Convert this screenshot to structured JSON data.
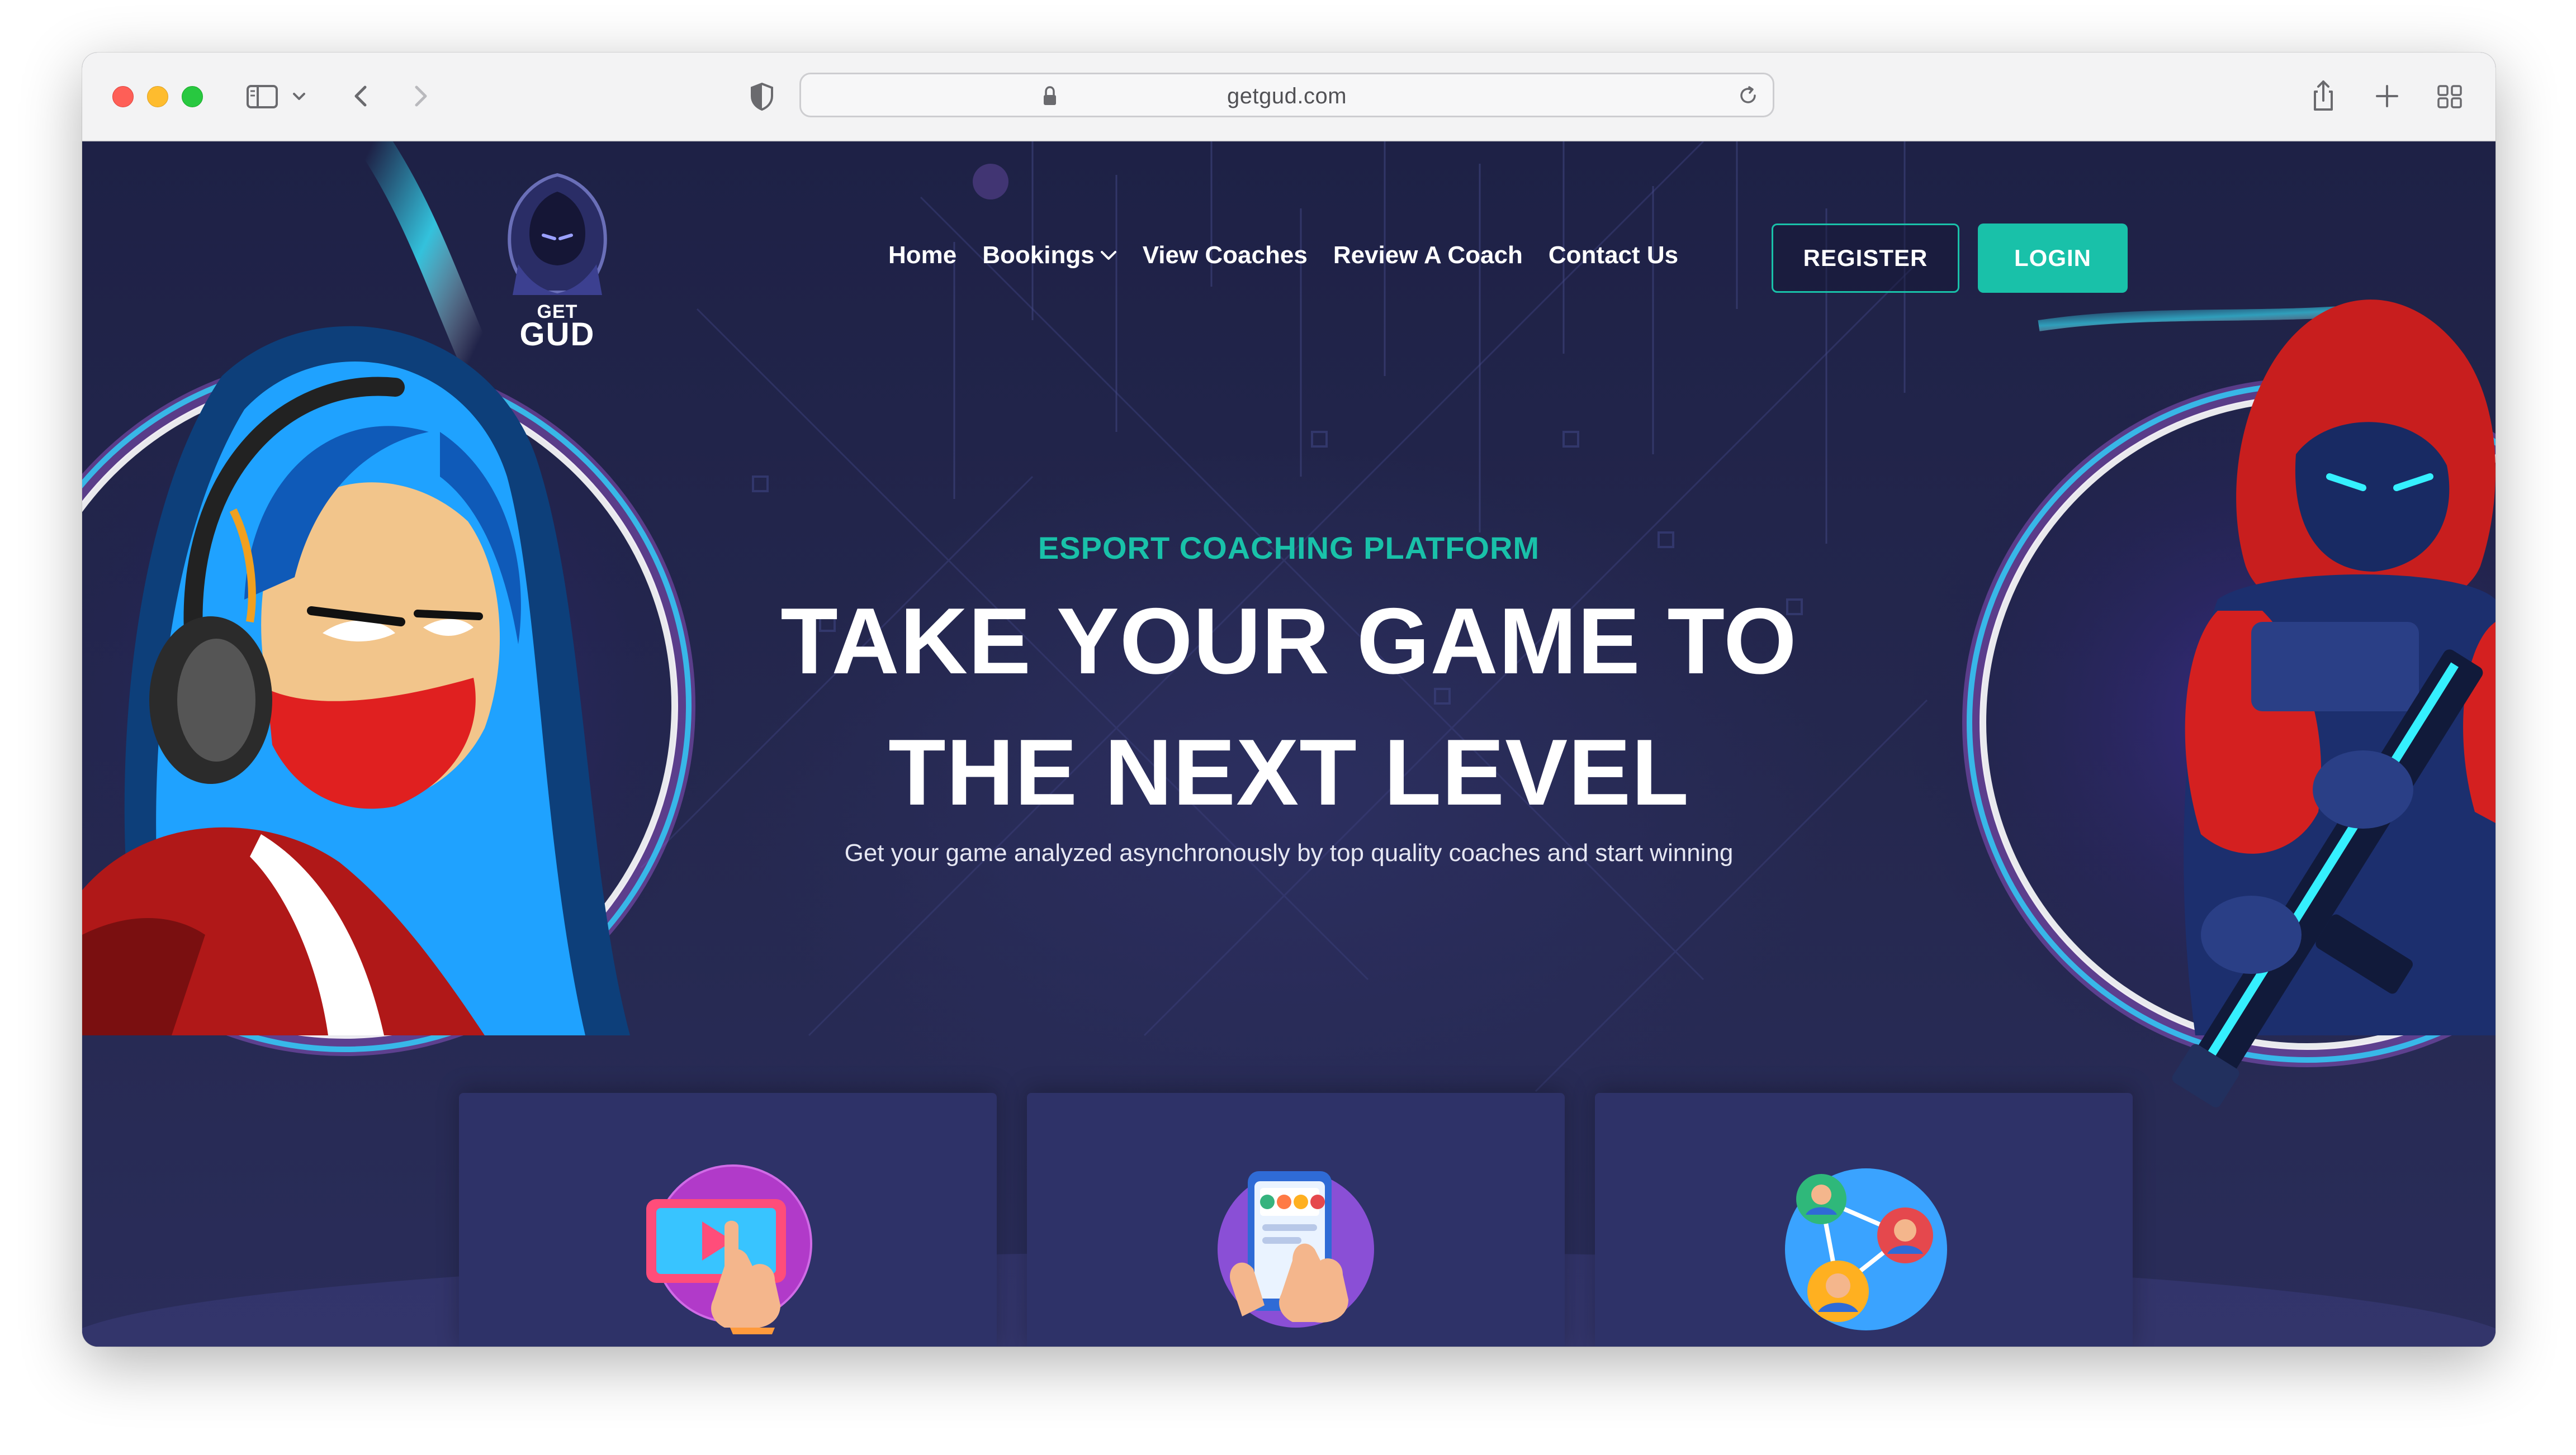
{
  "browser": {
    "url": "getgud.com"
  },
  "logo": {
    "line1": "GET",
    "line2": "GUD"
  },
  "nav": {
    "items": [
      "Home",
      "Bookings",
      "View Coaches",
      "Review A Coach",
      "Contact Us"
    ],
    "register": "REGISTER",
    "login": "LOGIN"
  },
  "hero": {
    "eyebrow": "ESPORT COACHING PLATFORM",
    "title_line1": "TAKE YOUR GAME TO",
    "title_line2": "THE NEXT LEVEL",
    "description": "Get your game analyzed asynchronously by top quality coaches and start winning"
  },
  "features": [
    {
      "icon": "video-tablet-icon"
    },
    {
      "icon": "phone-coaches-icon"
    },
    {
      "icon": "network-people-icon"
    }
  ],
  "colors": {
    "accent": "#19c1a9",
    "background": "#23264a",
    "card": "#2e3268"
  }
}
